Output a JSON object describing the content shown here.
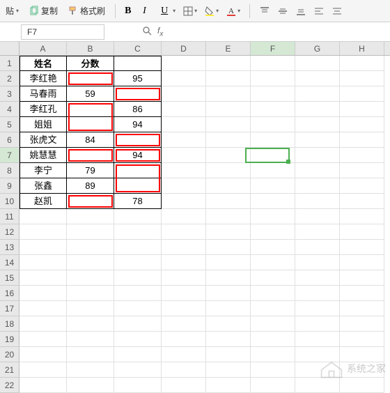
{
  "toolbar": {
    "paste_suffix": "贴",
    "copy_label": "复制",
    "format_painter_label": "格式刷",
    "bold": "B",
    "italic": "I",
    "underline": "U"
  },
  "namebox": {
    "value": "F7"
  },
  "formula": {
    "value": ""
  },
  "columns": [
    "A",
    "B",
    "C",
    "D",
    "E",
    "F",
    "G",
    "H"
  ],
  "sheet": {
    "headers": {
      "A": "姓名",
      "B": "分数"
    },
    "rows": [
      {
        "A": "李红艳",
        "B": "",
        "C": "95"
      },
      {
        "A": "马春雨",
        "B": "59",
        "C": ""
      },
      {
        "A": "李红孔",
        "B": "",
        "C": "86"
      },
      {
        "A": "姐姐",
        "B": "",
        "C": "94"
      },
      {
        "A": "张虎文",
        "B": "84",
        "C": ""
      },
      {
        "A": "姚慧慧",
        "B": "",
        "C": "94"
      },
      {
        "A": "李宁",
        "B": "79",
        "C": ""
      },
      {
        "A": "张鑫",
        "B": "89",
        "C": ""
      },
      {
        "A": "赵凯",
        "B": "",
        "C": "78"
      }
    ]
  },
  "chart_data": {
    "type": "table",
    "title": "",
    "columns": [
      "姓名",
      "分数",
      "C"
    ],
    "rows": [
      [
        "李红艳",
        null,
        95
      ],
      [
        "马春雨",
        59,
        null
      ],
      [
        "李红孔",
        null,
        86
      ],
      [
        "姐姐",
        null,
        94
      ],
      [
        "张虎文",
        84,
        null
      ],
      [
        "姚慧慧",
        null,
        94
      ],
      [
        "李宁",
        79,
        null
      ],
      [
        "张鑫",
        89,
        null
      ],
      [
        "赵凯",
        null,
        78
      ]
    ]
  },
  "active_cell": "F7",
  "watermark": {
    "text": "系统之家"
  }
}
